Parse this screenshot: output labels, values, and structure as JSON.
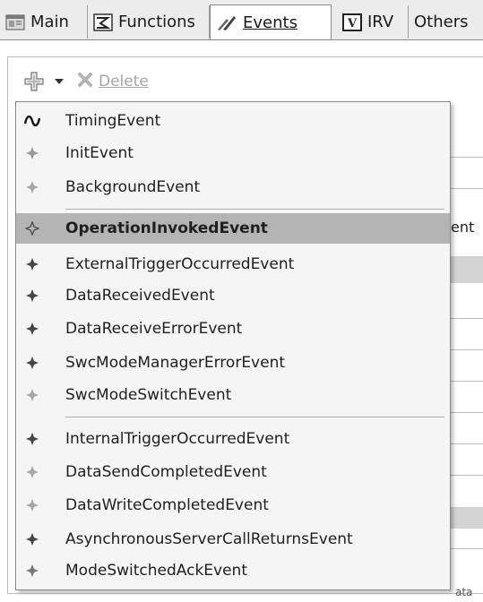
{
  "tabs": [
    {
      "label": "Main",
      "icon": "main-tab-icon",
      "active": false
    },
    {
      "label": "Functions",
      "icon": "functions-tab-icon",
      "active": false
    },
    {
      "label": "Events",
      "icon": "events-tab-icon",
      "active": true
    },
    {
      "label": "IRV",
      "icon": "irv-tab-icon",
      "active": false,
      "icon_text": "V"
    },
    {
      "label": "Others",
      "icon": "",
      "active": false
    }
  ],
  "toolbar": {
    "add_icon": "add-event-icon",
    "dropdown_icon": "dropdown-arrow-icon",
    "delete_icon": "delete-x-icon",
    "delete_label": "Delete",
    "delete_enabled": false
  },
  "menu": {
    "highlighted": "OperationInvokedEvent",
    "items": [
      {
        "label": "TimingEvent",
        "icon": "timing-wave-icon"
      },
      {
        "label": "InitEvent",
        "icon": "event-diamond-icon"
      },
      {
        "label": "BackgroundEvent",
        "icon": "event-diamond-icon"
      },
      {
        "label": "OperationInvokedEvent",
        "icon": "event-diamond-icon"
      },
      {
        "label": "ExternalTriggerOccurredEvent",
        "icon": "event-diamond-icon"
      },
      {
        "label": "DataReceivedEvent",
        "icon": "event-diamond-icon"
      },
      {
        "label": "DataReceiveErrorEvent",
        "icon": "event-diamond-icon"
      },
      {
        "label": "SwcModeManagerErrorEvent",
        "icon": "event-diamond-icon"
      },
      {
        "label": "SwcModeSwitchEvent",
        "icon": "event-diamond-icon"
      },
      {
        "label": "InternalTriggerOccurredEvent",
        "icon": "event-diamond-icon"
      },
      {
        "label": "DataSendCompletedEvent",
        "icon": "event-diamond-icon"
      },
      {
        "label": "DataWriteCompletedEvent",
        "icon": "event-diamond-icon"
      },
      {
        "label": "AsynchronousServerCallReturnsEvent",
        "icon": "event-diamond-icon"
      },
      {
        "label": "ModeSwitchedAckEvent",
        "icon": "event-diamond-icon"
      }
    ]
  },
  "background": {
    "column_fragment": "ent",
    "bottom_fragment": "ata"
  },
  "colors": {
    "menu_bg": "#f5f5f5",
    "highlight_bg": "#b4b4b4",
    "disabled_text": "#a6a6a6"
  }
}
